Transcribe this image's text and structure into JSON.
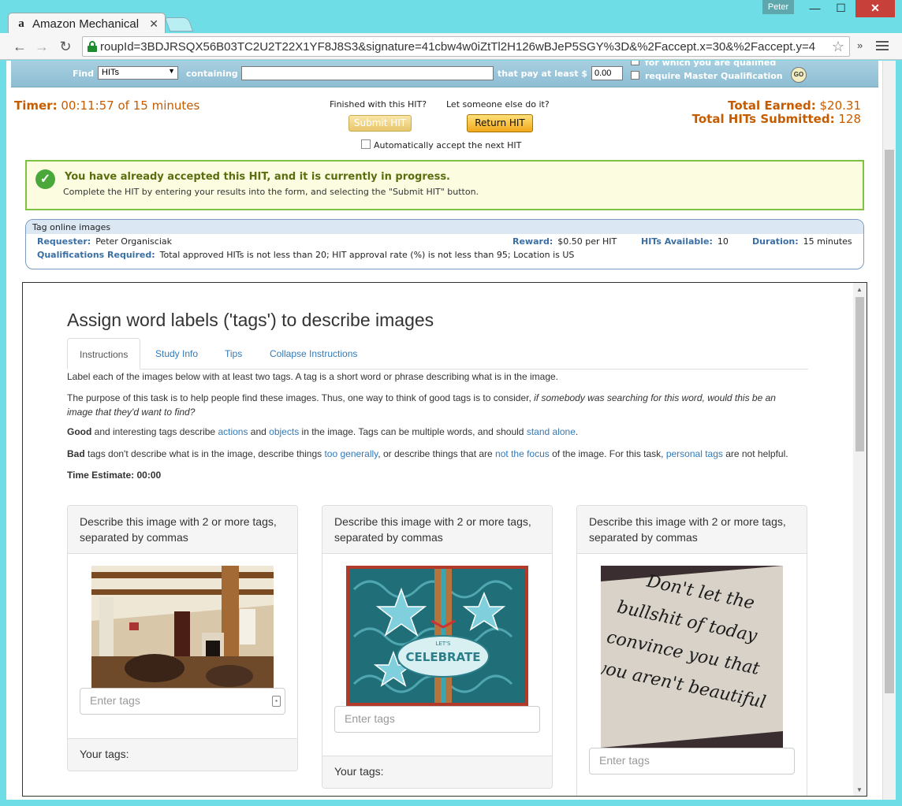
{
  "browser": {
    "tab_title": "Amazon Mechanical",
    "tab_favicon": "a",
    "profile": "Peter",
    "url": "roupId=3BDJRSQX56B03TC2U2T22X1YF8J8S3&signature=41cbw4w0iZtTl2H126wBJeP5SGY%3D&%2Faccept.x=30&%2Faccept.y=4",
    "icons": [
      "back-arrow-icon",
      "forward-arrow-icon",
      "reload-icon",
      "lock-icon",
      "star-icon",
      "menu-icon"
    ]
  },
  "search_bar": {
    "find_label": "Find",
    "select_value": "HITs",
    "containing_label": "containing",
    "pay_label": "that pay at least $",
    "amount_value": "0.00",
    "qualified_label": "for which you are qualified",
    "master_label": "require Master Qualification",
    "go_label": "GO"
  },
  "hit_status": {
    "timer_label": "Timer:",
    "timer_value": "00:11:57 of 15 minutes",
    "finished_label": "Finished with this HIT?",
    "else_label": "Let someone else do it?",
    "submit_label": "Submit HIT",
    "return_label": "Return HIT",
    "auto_accept_label": "Automatically accept the next HIT",
    "total_earned_label": "Total Earned:",
    "total_earned_value": "$20.31",
    "total_submitted_label": "Total HITs Submitted:",
    "total_submitted_value": "128"
  },
  "alert": {
    "title": "You have already accepted this HIT, and it is currently in progress.",
    "subtitle": "Complete the HIT by entering your results into the form, and selecting the \"Submit HIT\" button."
  },
  "hit_info": {
    "title": "Tag online images",
    "requester_label": "Requester:",
    "requester_value": "Peter Organisciak",
    "reward_label": "Reward:",
    "reward_value": "$0.50 per HIT",
    "available_label": "HITs Available:",
    "available_value": "10",
    "duration_label": "Duration:",
    "duration_value": "15 minutes",
    "quals_label": "Qualifications Required:",
    "quals_value": "Total approved HITs is not less than 20; HIT approval rate (%) is not less than 95; Location is US"
  },
  "task": {
    "title": "Assign word labels ('tags') to describe images",
    "tabs": [
      "Instructions",
      "Study Info",
      "Tips",
      "Collapse Instructions"
    ],
    "p1": "Label each of the images below with at least two tags. A tag is a short word or phrase describing what is in the image.",
    "p2_start": "The purpose of this task is to help people find these images. Thus, one way to think of good tags is to consider, ",
    "p2_italic": "if somebody was searching for this word, would this be an image that they'd want to find?",
    "p3_bold": "Good",
    "p3_a": " and interesting tags describe ",
    "p3_link1": "actions",
    "p3_b": " and ",
    "p3_link2": "objects",
    "p3_c": " in the image. Tags can be multiple words, and should ",
    "p3_link3": "stand alone",
    "p3_d": ".",
    "p4_bold": "Bad",
    "p4_a": " tags don't describe what is in the image, describe things ",
    "p4_link1": "too generally",
    "p4_b": ", or describe things that are ",
    "p4_link2": "not the focus",
    "p4_c": " of the image. For this task, ",
    "p4_link3": "personal tags",
    "p4_d": " are not helpful.",
    "time_estimate": "Time Estimate: 00:00",
    "panels": [
      {
        "heading": "Describe this image with 2 or more tags, separated by commas",
        "placeholder": "Enter tags",
        "footer": "Your tags:"
      },
      {
        "heading": "Describe this image with 2 or more tags, separated by commas",
        "placeholder": "Enter tags",
        "footer": "Your tags:",
        "image_text": "LET'S CELEBRATE"
      },
      {
        "heading": "Describe this image with 2 or more tags, separated by commas",
        "placeholder": "Enter tags",
        "image_text": "Don't let the bullshit of today convince you that you aren't beautiful"
      }
    ]
  }
}
